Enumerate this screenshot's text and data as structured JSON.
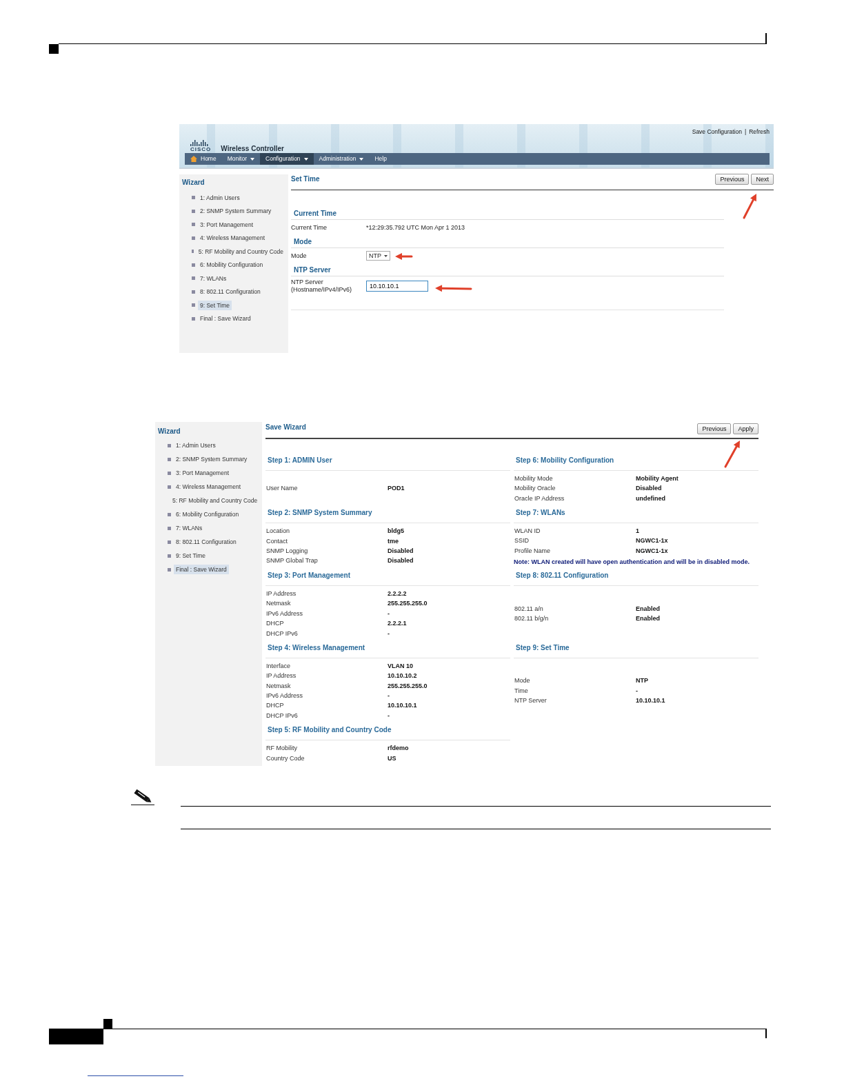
{
  "screen1": {
    "header": {
      "logo_text": "CISCO",
      "product": "Wireless Controller",
      "links": [
        {
          "label": "Save Configuration"
        },
        {
          "label": "Refresh"
        }
      ],
      "link_separator": "|"
    },
    "menu": [
      {
        "label": "Home",
        "kind": "home",
        "dropdown": false,
        "selected": false
      },
      {
        "label": "Monitor",
        "kind": "plain",
        "dropdown": true,
        "selected": false
      },
      {
        "label": "Configuration",
        "kind": "plain",
        "dropdown": true,
        "selected": true
      },
      {
        "label": "Administration",
        "kind": "plain",
        "dropdown": true,
        "selected": false
      },
      {
        "label": "Help",
        "kind": "plain",
        "dropdown": false,
        "selected": false
      }
    ],
    "sidebar": {
      "title": "Wizard",
      "items": [
        {
          "label": "1: Admin Users",
          "selected": false
        },
        {
          "label": "2: SNMP System Summary",
          "selected": false
        },
        {
          "label": "3: Port Management",
          "selected": false
        },
        {
          "label": "4: Wireless Management",
          "selected": false
        },
        {
          "label": "5: RF Mobility and Country Code",
          "selected": false
        },
        {
          "label": "6: Mobility Configuration",
          "selected": false
        },
        {
          "label": "7: WLANs",
          "selected": false
        },
        {
          "label": "8: 802.11 Configuration",
          "selected": false
        },
        {
          "label": "9: Set Time",
          "selected": true
        },
        {
          "label": "Final : Save Wizard",
          "selected": false
        }
      ]
    },
    "page_title": "Set Time",
    "buttons": [
      {
        "label": "Previous"
      },
      {
        "label": "Next"
      }
    ],
    "sections": [
      {
        "title": "Current Time",
        "fields": [
          {
            "kind": "text",
            "label": "Current Time",
            "value": "*12:29:35.792 UTC Mon Apr 1 2013"
          }
        ]
      },
      {
        "title": "Mode",
        "fields": [
          {
            "kind": "select",
            "label": "Mode",
            "value": "NTP"
          }
        ]
      },
      {
        "title": "NTP Server",
        "fields": [
          {
            "kind": "input",
            "label": "NTP Server",
            "sublabel": "(Hostname/IPv4/IPv6)",
            "value": "10.10.10.1"
          }
        ]
      }
    ]
  },
  "screen2": {
    "sidebar": {
      "title": "Wizard",
      "items": [
        {
          "label": "1: Admin Users",
          "selected": false
        },
        {
          "label": "2: SNMP System Summary",
          "selected": false
        },
        {
          "label": "3: Port Management",
          "selected": false
        },
        {
          "label": "4: Wireless Management",
          "selected": false
        },
        {
          "label": "5: RF Mobility and Country Code",
          "selected": false
        },
        {
          "label": "6: Mobility Configuration",
          "selected": false
        },
        {
          "label": "7: WLANs",
          "selected": false
        },
        {
          "label": "8: 802.11 Configuration",
          "selected": false
        },
        {
          "label": "9: Set Time",
          "selected": false
        },
        {
          "label": "Final : Save Wizard",
          "selected": true
        }
      ]
    },
    "page_title": "Save Wizard",
    "buttons": [
      {
        "label": "Previous"
      },
      {
        "label": "Apply"
      }
    ],
    "summary_rows": [
      {
        "sections": [
          {
            "title": "Step 1: ADMIN User",
            "fields": [
              {
                "label": "User Name",
                "value": "POD1"
              }
            ]
          },
          {
            "title": "Step 6: Mobility Configuration",
            "fields": [
              {
                "label": "Mobility Mode",
                "value": "Mobility Agent"
              },
              {
                "label": "Mobility Oracle",
                "value": "Disabled"
              },
              {
                "label": "Oracle IP Address",
                "value": "undefined"
              }
            ]
          }
        ]
      },
      {
        "sections": [
          {
            "title": "Step 2: SNMP System Summary",
            "fields": [
              {
                "label": "Location",
                "value": "bldg5"
              },
              {
                "label": "Contact",
                "value": "tme"
              },
              {
                "label": "SNMP Logging",
                "value": "Disabled"
              },
              {
                "label": "SNMP Global Trap",
                "value": "Disabled"
              }
            ]
          },
          {
            "title": "Step 7: WLANs",
            "fields": [
              {
                "label": "WLAN ID",
                "value": "1"
              },
              {
                "label": "SSID",
                "value": "NGWC1-1x"
              },
              {
                "label": "Profile Name",
                "value": "NGWC1-1x"
              }
            ],
            "note": "Note: WLAN created will have open authentication and will be in disabled mode."
          }
        ]
      },
      {
        "sections": [
          {
            "title": "Step 3: Port Management",
            "fields": [
              {
                "label": "IP Address",
                "value": "2.2.2.2"
              },
              {
                "label": "Netmask",
                "value": "255.255.255.0"
              },
              {
                "label": "IPv6 Address",
                "value": "-"
              },
              {
                "label": "DHCP",
                "value": "2.2.2.1"
              },
              {
                "label": "DHCP IPv6",
                "value": "-"
              }
            ]
          },
          {
            "title": "Step 8: 802.11 Configuration",
            "fields": [
              {
                "label": "802.11 a/n",
                "value": "Enabled"
              },
              {
                "label": "802.11 b/g/n",
                "value": "Enabled"
              }
            ]
          }
        ]
      },
      {
        "sections": [
          {
            "title": "Step 4: Wireless Management",
            "fields": [
              {
                "label": "Interface",
                "value": "VLAN 10"
              },
              {
                "label": "IP Address",
                "value": "10.10.10.2"
              },
              {
                "label": "Netmask",
                "value": "255.255.255.0"
              },
              {
                "label": "IPv6 Address",
                "value": "-"
              },
              {
                "label": "DHCP",
                "value": "10.10.10.1"
              },
              {
                "label": "DHCP IPv6",
                "value": "-"
              }
            ]
          },
          {
            "title": "Step 9: Set Time",
            "fields": [
              {
                "label": "Mode",
                "value": "NTP"
              },
              {
                "label": "Time",
                "value": "-"
              },
              {
                "label": "NTP Server",
                "value": "10.10.10.1"
              }
            ]
          }
        ]
      },
      {
        "sections": [
          {
            "title": "Step 5: RF Mobility and Country Code",
            "fields": [
              {
                "label": "RF Mobility",
                "value": "rfdemo"
              },
              {
                "label": "Country Code",
                "value": "US"
              }
            ]
          }
        ]
      }
    ]
  }
}
